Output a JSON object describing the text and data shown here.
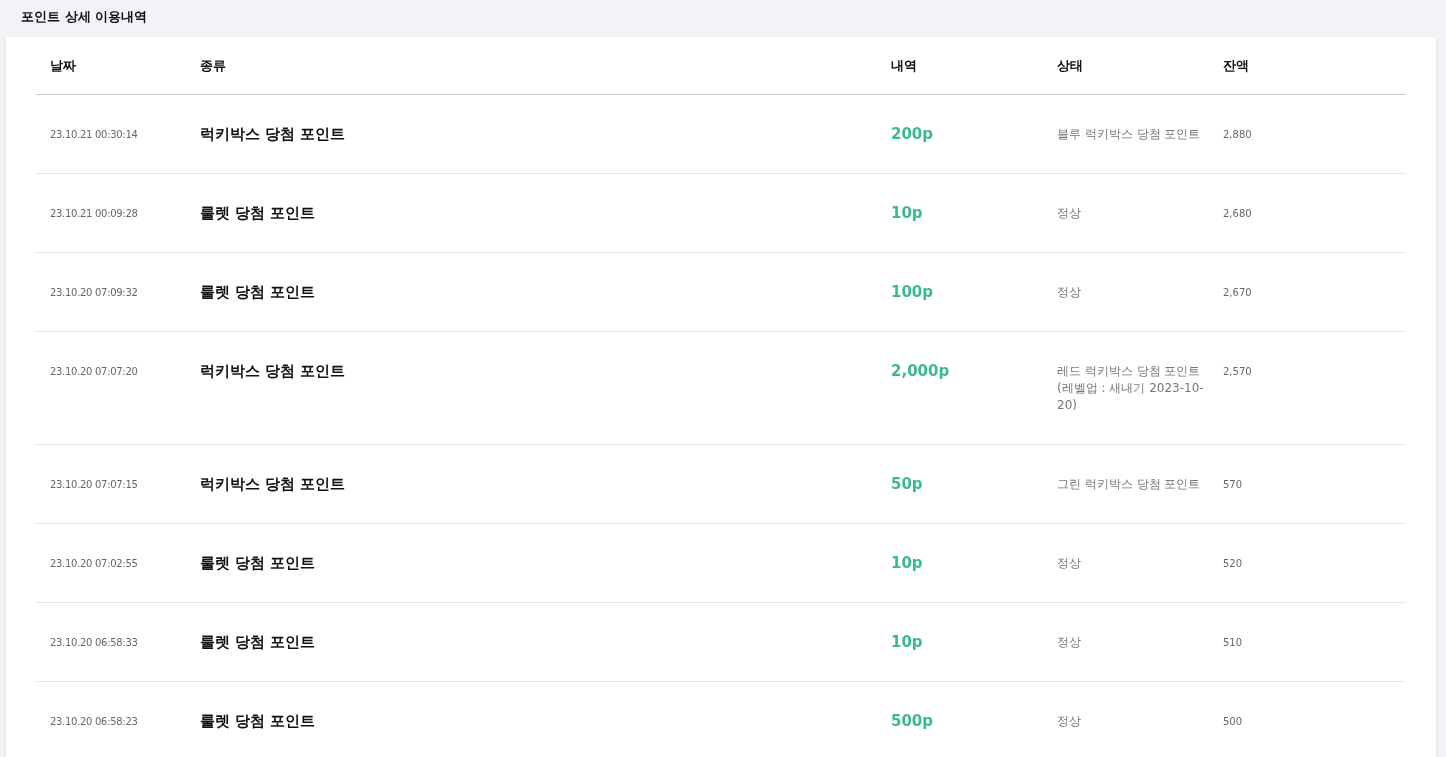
{
  "page_title": "포인트 상세 이용내역",
  "table": {
    "columns": [
      "날짜",
      "종류",
      "내역",
      "상태",
      "잔액"
    ],
    "rows": [
      {
        "date": "23.10.21 00:30:14",
        "type": "럭키박스 당첨 포인트",
        "amount": "200p",
        "status": [
          "블루 럭키박스 당첨 포인트"
        ],
        "balance": "2,880"
      },
      {
        "date": "23.10.21 00:09:28",
        "type": "룰렛 당첨 포인트",
        "amount": "10p",
        "status": [
          "정상"
        ],
        "balance": "2,680"
      },
      {
        "date": "23.10.20 07:09:32",
        "type": "룰렛 당첨 포인트",
        "amount": "100p",
        "status": [
          "정상"
        ],
        "balance": "2,670"
      },
      {
        "date": "23.10.20 07:07:20",
        "type": "럭키박스 당첨 포인트",
        "amount": "2,000p",
        "status": [
          "레드 럭키박스 당첨 포인트",
          "(레벨업 : 새내기 2023-10-20)"
        ],
        "balance": "2,570"
      },
      {
        "date": "23.10.20 07:07:15",
        "type": "럭키박스 당첨 포인트",
        "amount": "50p",
        "status": [
          "그린 럭키박스 당첨 포인트"
        ],
        "balance": "570"
      },
      {
        "date": "23.10.20 07:02:55",
        "type": "룰렛 당첨 포인트",
        "amount": "10p",
        "status": [
          "정상"
        ],
        "balance": "520"
      },
      {
        "date": "23.10.20 06:58:33",
        "type": "룰렛 당첨 포인트",
        "amount": "10p",
        "status": [
          "정상"
        ],
        "balance": "510"
      },
      {
        "date": "23.10.20 06:58:23",
        "type": "룰렛 당첨 포인트",
        "amount": "500p",
        "status": [
          "정상"
        ],
        "balance": "500"
      }
    ]
  }
}
